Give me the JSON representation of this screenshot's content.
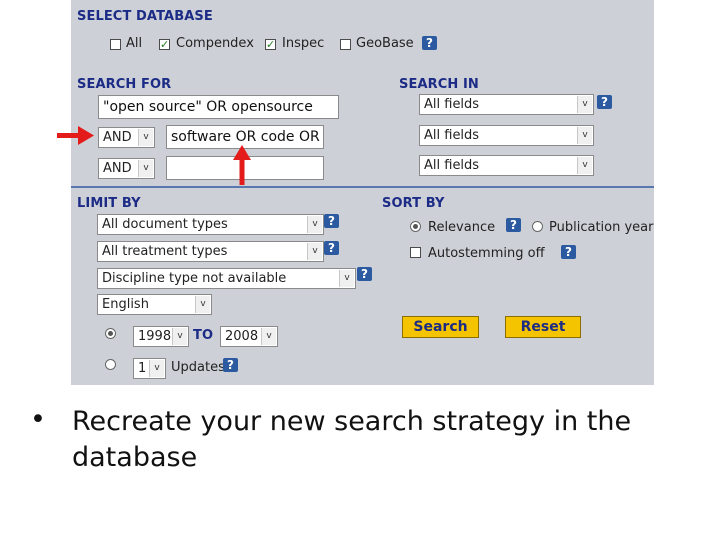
{
  "select_database": {
    "heading": "SELECT DATABASE",
    "options": [
      {
        "label": "All",
        "checked": false
      },
      {
        "label": "Compendex",
        "checked": true
      },
      {
        "label": "Inspec",
        "checked": true
      },
      {
        "label": "GeoBase",
        "checked": false
      }
    ]
  },
  "search_for": {
    "heading": "SEARCH FOR",
    "terms": [
      "\"open source\" OR opensource",
      "software OR code OR",
      ""
    ],
    "connectors": [
      "AND",
      "AND"
    ]
  },
  "search_in": {
    "heading": "SEARCH IN",
    "fields": [
      "All fields",
      "All fields",
      "All fields"
    ]
  },
  "limit_by": {
    "heading": "LIMIT BY",
    "document_type": "All document types",
    "treatment_type": "All treatment types",
    "discipline_type": "Discipline type not available",
    "language": "English",
    "year_from": "1998",
    "year_to_label": "TO",
    "year_to": "2008",
    "updates_value": "1",
    "updates_label": "Updates"
  },
  "sort_by": {
    "heading": "SORT BY",
    "relevance": "Relevance",
    "publication_year": "Publication year",
    "autostemming": "Autostemming off"
  },
  "buttons": {
    "search": "Search",
    "reset": "Reset"
  },
  "help_glyph": "?",
  "dropdown_glyph": "v",
  "bullet_text": "Recreate your new search strategy in the database",
  "colors": {
    "panel": "#cdd0d6",
    "heading": "#1c2b86",
    "button": "#f5c400",
    "arrow": "#e31b1b",
    "help": "#2c5aa0"
  }
}
